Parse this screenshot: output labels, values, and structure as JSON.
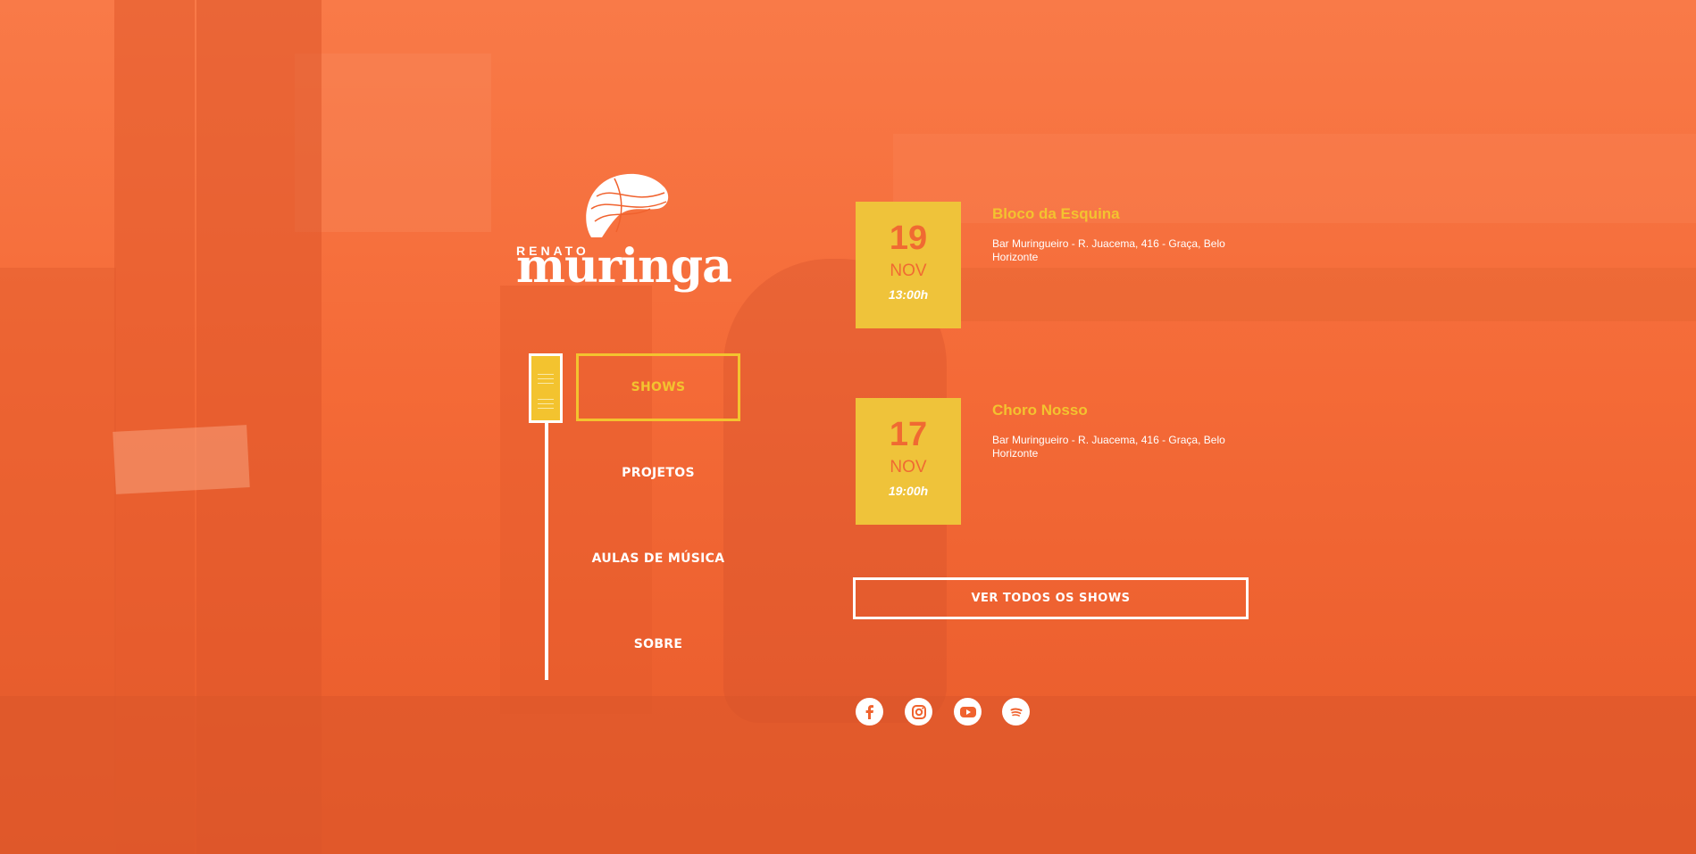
{
  "brand": {
    "first_name": "RENATO",
    "last_name": "muringa"
  },
  "nav": {
    "items": [
      {
        "label": "SHOWS",
        "active": true
      },
      {
        "label": "PROJETOS",
        "active": false
      },
      {
        "label": "AULAS DE MÚSICA",
        "active": false
      },
      {
        "label": "SOBRE",
        "active": false
      }
    ]
  },
  "shows": [
    {
      "day": "19",
      "month": "NOV",
      "time": "13:00h",
      "title": "Bloco da Esquina",
      "address": "Bar Muringueiro - R. Juacema, 416 - Graça, Belo Horizonte"
    },
    {
      "day": "17",
      "month": "NOV",
      "time": "19:00h",
      "title": "Choro Nosso",
      "address": "Bar Muringueiro - R. Juacema, 416 - Graça, Belo Horizonte"
    }
  ],
  "all_shows_button": "VER TODOS OS SHOWS",
  "social": [
    "facebook-icon",
    "instagram-icon",
    "youtube-icon",
    "spotify-icon"
  ],
  "colors": {
    "background": "#f0622e",
    "accent": "#f3c32f",
    "date_box": "#efc33a",
    "date_text": "#f06a32",
    "text": "#ffffff"
  }
}
